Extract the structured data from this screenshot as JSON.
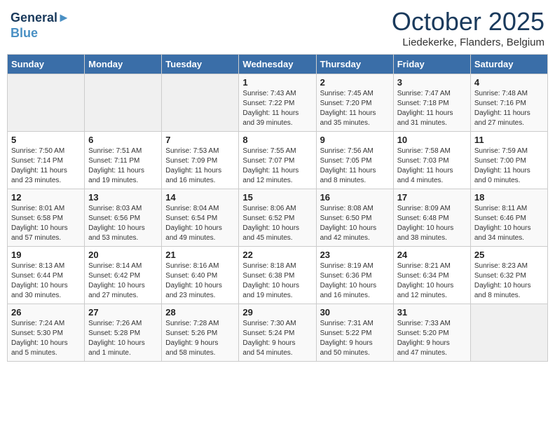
{
  "header": {
    "logo_line1": "General",
    "logo_line2": "Blue",
    "month_year": "October 2025",
    "location": "Liedekerke, Flanders, Belgium"
  },
  "weekdays": [
    "Sunday",
    "Monday",
    "Tuesday",
    "Wednesday",
    "Thursday",
    "Friday",
    "Saturday"
  ],
  "weeks": [
    [
      {
        "day": "",
        "info": ""
      },
      {
        "day": "",
        "info": ""
      },
      {
        "day": "",
        "info": ""
      },
      {
        "day": "1",
        "info": "Sunrise: 7:43 AM\nSunset: 7:22 PM\nDaylight: 11 hours\nand 39 minutes."
      },
      {
        "day": "2",
        "info": "Sunrise: 7:45 AM\nSunset: 7:20 PM\nDaylight: 11 hours\nand 35 minutes."
      },
      {
        "day": "3",
        "info": "Sunrise: 7:47 AM\nSunset: 7:18 PM\nDaylight: 11 hours\nand 31 minutes."
      },
      {
        "day": "4",
        "info": "Sunrise: 7:48 AM\nSunset: 7:16 PM\nDaylight: 11 hours\nand 27 minutes."
      }
    ],
    [
      {
        "day": "5",
        "info": "Sunrise: 7:50 AM\nSunset: 7:14 PM\nDaylight: 11 hours\nand 23 minutes."
      },
      {
        "day": "6",
        "info": "Sunrise: 7:51 AM\nSunset: 7:11 PM\nDaylight: 11 hours\nand 19 minutes."
      },
      {
        "day": "7",
        "info": "Sunrise: 7:53 AM\nSunset: 7:09 PM\nDaylight: 11 hours\nand 16 minutes."
      },
      {
        "day": "8",
        "info": "Sunrise: 7:55 AM\nSunset: 7:07 PM\nDaylight: 11 hours\nand 12 minutes."
      },
      {
        "day": "9",
        "info": "Sunrise: 7:56 AM\nSunset: 7:05 PM\nDaylight: 11 hours\nand 8 minutes."
      },
      {
        "day": "10",
        "info": "Sunrise: 7:58 AM\nSunset: 7:03 PM\nDaylight: 11 hours\nand 4 minutes."
      },
      {
        "day": "11",
        "info": "Sunrise: 7:59 AM\nSunset: 7:00 PM\nDaylight: 11 hours\nand 0 minutes."
      }
    ],
    [
      {
        "day": "12",
        "info": "Sunrise: 8:01 AM\nSunset: 6:58 PM\nDaylight: 10 hours\nand 57 minutes."
      },
      {
        "day": "13",
        "info": "Sunrise: 8:03 AM\nSunset: 6:56 PM\nDaylight: 10 hours\nand 53 minutes."
      },
      {
        "day": "14",
        "info": "Sunrise: 8:04 AM\nSunset: 6:54 PM\nDaylight: 10 hours\nand 49 minutes."
      },
      {
        "day": "15",
        "info": "Sunrise: 8:06 AM\nSunset: 6:52 PM\nDaylight: 10 hours\nand 45 minutes."
      },
      {
        "day": "16",
        "info": "Sunrise: 8:08 AM\nSunset: 6:50 PM\nDaylight: 10 hours\nand 42 minutes."
      },
      {
        "day": "17",
        "info": "Sunrise: 8:09 AM\nSunset: 6:48 PM\nDaylight: 10 hours\nand 38 minutes."
      },
      {
        "day": "18",
        "info": "Sunrise: 8:11 AM\nSunset: 6:46 PM\nDaylight: 10 hours\nand 34 minutes."
      }
    ],
    [
      {
        "day": "19",
        "info": "Sunrise: 8:13 AM\nSunset: 6:44 PM\nDaylight: 10 hours\nand 30 minutes."
      },
      {
        "day": "20",
        "info": "Sunrise: 8:14 AM\nSunset: 6:42 PM\nDaylight: 10 hours\nand 27 minutes."
      },
      {
        "day": "21",
        "info": "Sunrise: 8:16 AM\nSunset: 6:40 PM\nDaylight: 10 hours\nand 23 minutes."
      },
      {
        "day": "22",
        "info": "Sunrise: 8:18 AM\nSunset: 6:38 PM\nDaylight: 10 hours\nand 19 minutes."
      },
      {
        "day": "23",
        "info": "Sunrise: 8:19 AM\nSunset: 6:36 PM\nDaylight: 10 hours\nand 16 minutes."
      },
      {
        "day": "24",
        "info": "Sunrise: 8:21 AM\nSunset: 6:34 PM\nDaylight: 10 hours\nand 12 minutes."
      },
      {
        "day": "25",
        "info": "Sunrise: 8:23 AM\nSunset: 6:32 PM\nDaylight: 10 hours\nand 8 minutes."
      }
    ],
    [
      {
        "day": "26",
        "info": "Sunrise: 7:24 AM\nSunset: 5:30 PM\nDaylight: 10 hours\nand 5 minutes."
      },
      {
        "day": "27",
        "info": "Sunrise: 7:26 AM\nSunset: 5:28 PM\nDaylight: 10 hours\nand 1 minute."
      },
      {
        "day": "28",
        "info": "Sunrise: 7:28 AM\nSunset: 5:26 PM\nDaylight: 9 hours\nand 58 minutes."
      },
      {
        "day": "29",
        "info": "Sunrise: 7:30 AM\nSunset: 5:24 PM\nDaylight: 9 hours\nand 54 minutes."
      },
      {
        "day": "30",
        "info": "Sunrise: 7:31 AM\nSunset: 5:22 PM\nDaylight: 9 hours\nand 50 minutes."
      },
      {
        "day": "31",
        "info": "Sunrise: 7:33 AM\nSunset: 5:20 PM\nDaylight: 9 hours\nand 47 minutes."
      },
      {
        "day": "",
        "info": ""
      }
    ]
  ]
}
